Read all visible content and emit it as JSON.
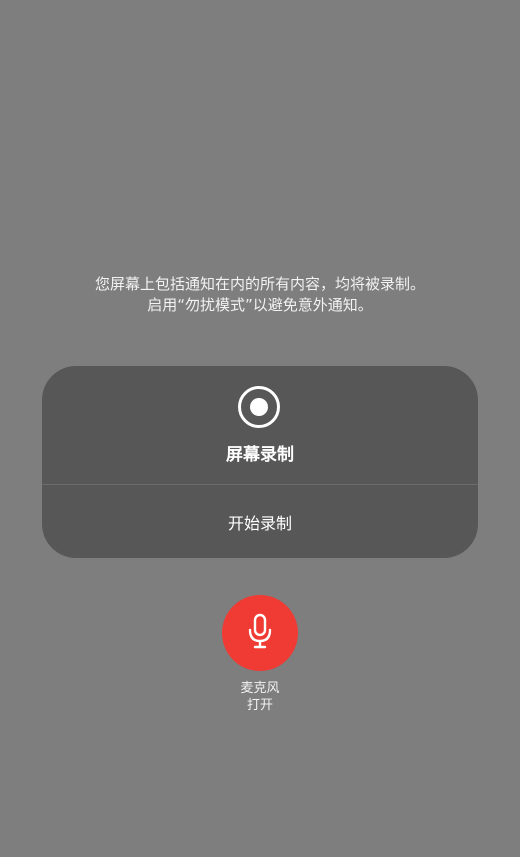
{
  "notice": {
    "line1": "您屏幕上包括通知在内的所有内容，均将被录制。",
    "line2": "启用“勿扰模式”以避免意外通知。"
  },
  "card": {
    "icon": "record-icon",
    "title": "屏幕录制",
    "start_label": "开始录制"
  },
  "microphone": {
    "icon": "microphone-icon",
    "label": "麦克风",
    "state": "打开",
    "color": "#ef3b33"
  }
}
